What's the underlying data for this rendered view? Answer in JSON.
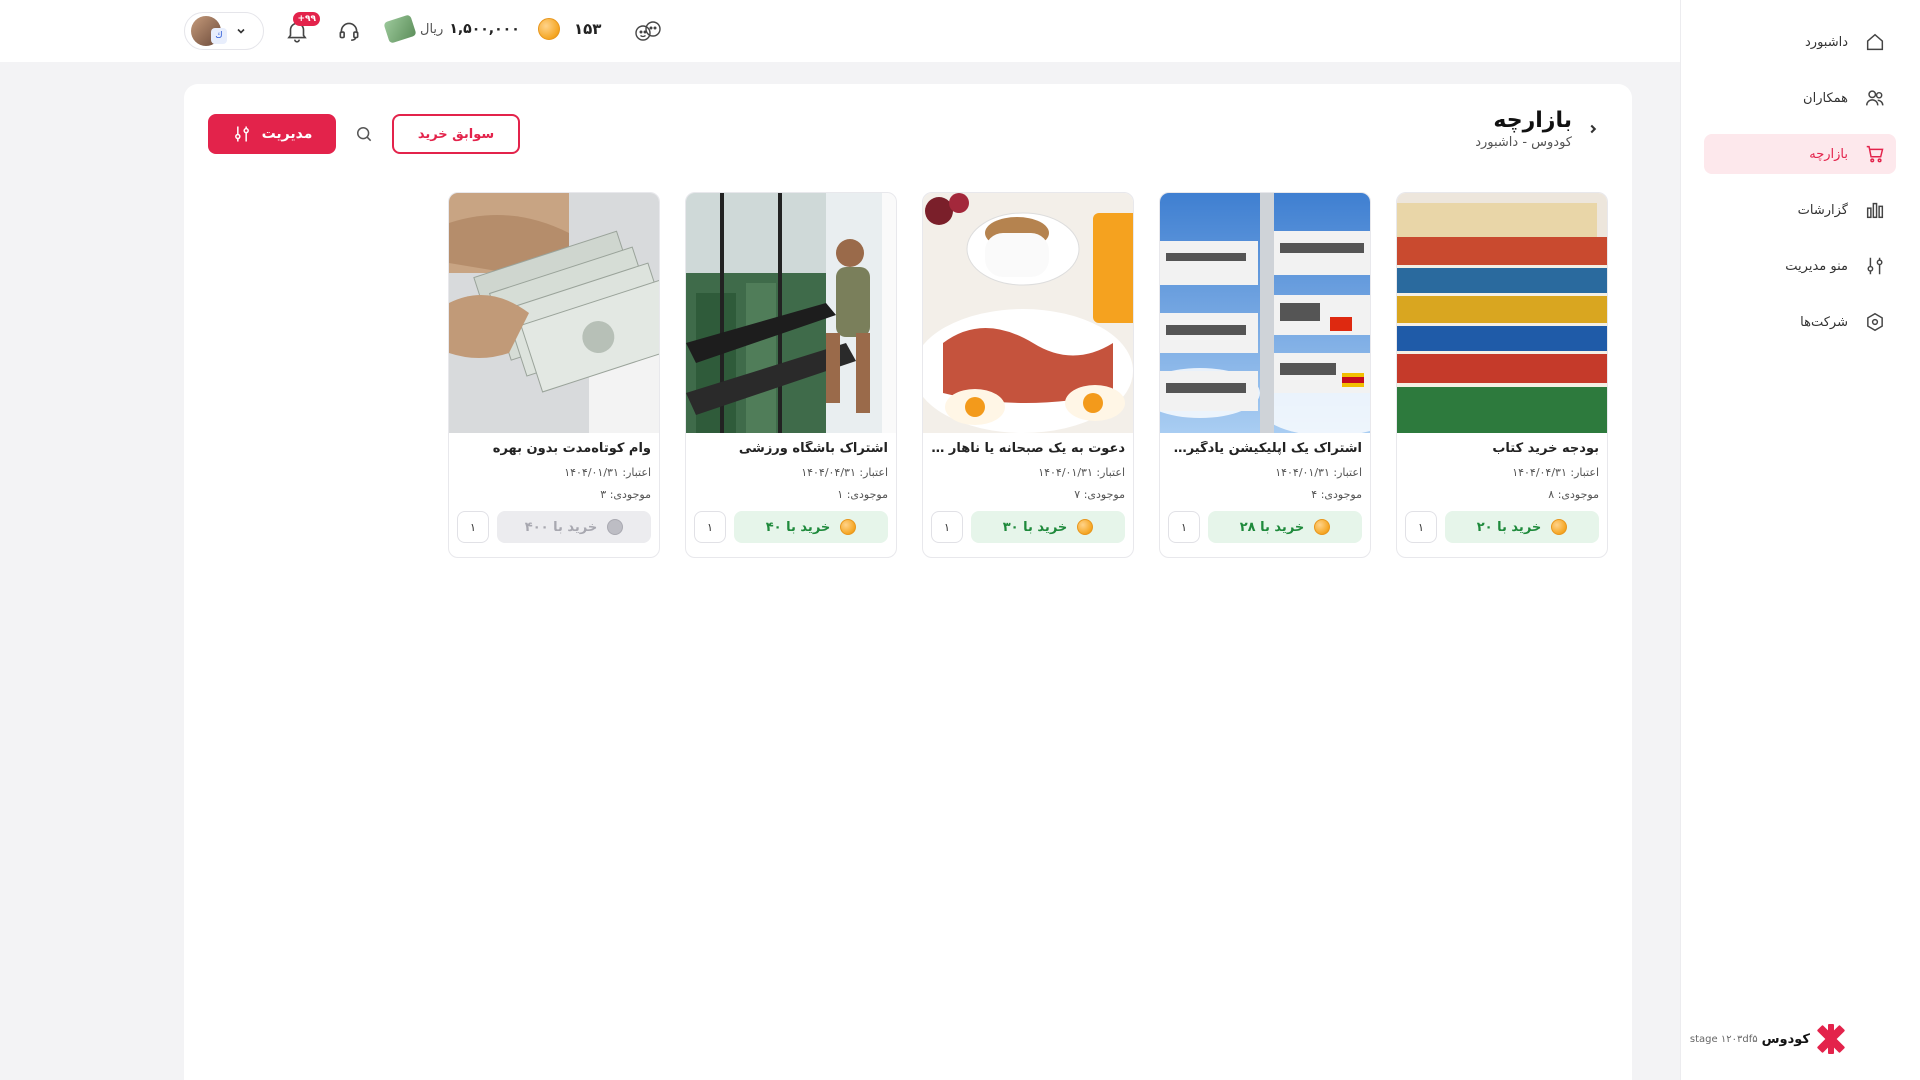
{
  "sidebar": {
    "items": [
      {
        "label": "داشبورد",
        "icon": "home-icon"
      },
      {
        "label": "همکاران",
        "icon": "users-icon"
      },
      {
        "label": "بازارچه",
        "icon": "cart-icon",
        "active": true
      },
      {
        "label": "گزارشات",
        "icon": "bar-chart-icon"
      },
      {
        "label": "منو مدیریت",
        "icon": "sliders-icon"
      },
      {
        "label": "شرکت‌ها",
        "icon": "hexagon-icon"
      }
    ],
    "brand_name": "کودوس",
    "brand_env": "stage ۱۲۰۳df۵"
  },
  "topbar": {
    "notifications_badge": "+۹۹",
    "wallet_amount": "۱,۵۰۰,۰۰۰",
    "wallet_unit": "ریال",
    "coins_count": "۱۵۳"
  },
  "page": {
    "title": "بازارچه",
    "breadcrumb": "کودوس - داشبورد",
    "manage_label": "مدیریت",
    "history_label": "سوابق خرید"
  },
  "products": [
    {
      "name": "بودجه خرید کتاب",
      "validity": "اعتبار: ۱۴۰۴/۰۴/۳۱",
      "stock": "موجودی: ۸",
      "buy_label": "خرید با ۲۰",
      "qty": "۱",
      "disabled": false,
      "image": "books"
    },
    {
      "name": "اشتراک یک اپلیکیشن یادگیری زبان",
      "validity": "اعتبار: ۱۴۰۴/۰۱/۳۱",
      "stock": "موجودی: ۴",
      "buy_label": "خرید با ۲۸",
      "qty": "۱",
      "disabled": false,
      "image": "language-signpost"
    },
    {
      "name": "دعوت به یک صبحانه یا ناهار کاری",
      "validity": "اعتبار: ۱۴۰۴/۰۱/۳۱",
      "stock": "موجودی: ۷",
      "buy_label": "خرید با ۳۰",
      "qty": "۱",
      "disabled": false,
      "image": "breakfast"
    },
    {
      "name": "اشتراک باشگاه ورزشی",
      "validity": "اعتبار: ۱۴۰۴/۰۴/۳۱",
      "stock": "موجودی: ۱",
      "buy_label": "خرید با ۴۰",
      "qty": "۱",
      "disabled": false,
      "image": "gym-treadmill"
    },
    {
      "name": "وام کوتاه‌مدت بدون بهره",
      "validity": "اعتبار: ۱۴۰۴/۰۱/۳۱",
      "stock": "موجودی: ۳",
      "buy_label": "خرید با ۴۰۰",
      "qty": "۱",
      "disabled": true,
      "image": "cash-money"
    }
  ],
  "colors": {
    "accent": "#e3234b",
    "active_bg": "#fde8ec",
    "buy_bg": "#e6f5ea",
    "buy_text": "#1f8a3c",
    "coin": "#f5a623"
  }
}
